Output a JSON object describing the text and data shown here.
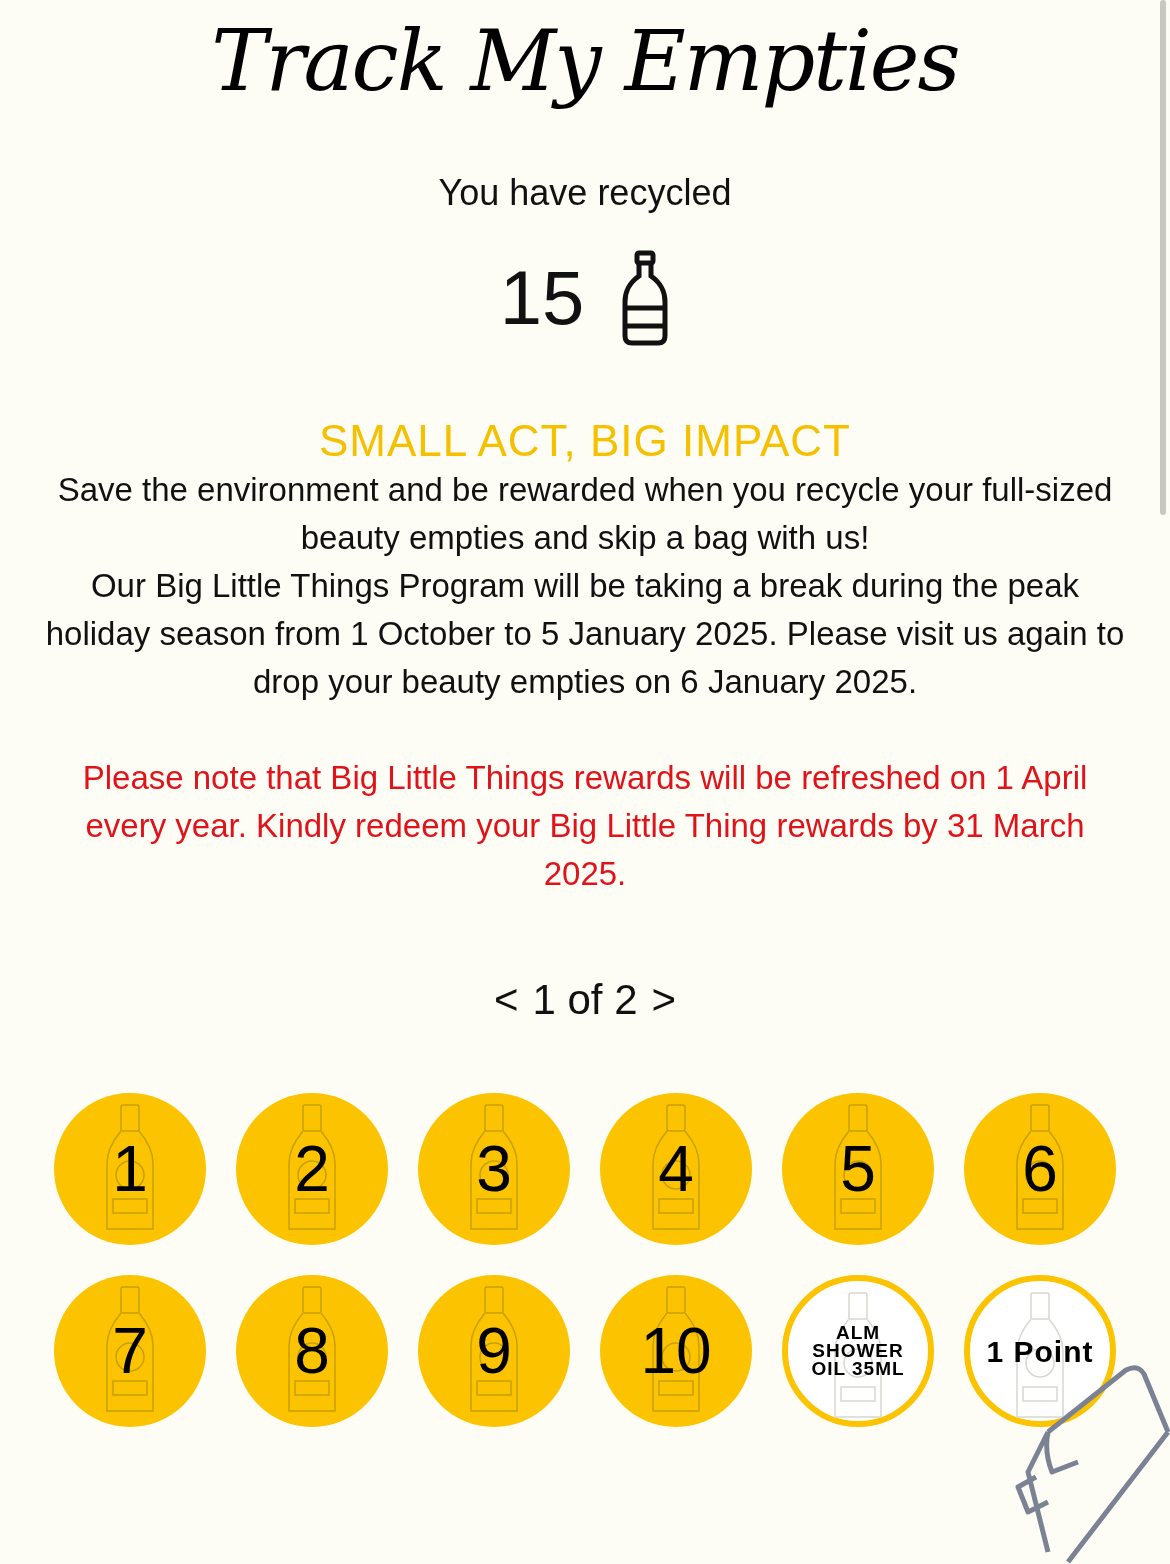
{
  "title": "Track My Empties",
  "recycled": {
    "label": "You have recycled",
    "count": "15"
  },
  "heading": "SMALL ACT, BIG IMPACT",
  "paragraphs": [
    "Save the environment and be rewarded when you recycle your full-sized beauty empties and skip a bag with us!",
    "Our Big Little Things Program will be taking a break during the peak holiday season from 1 October to 5 January 2025. Please visit us again to drop your beauty empties on 6 January 2025."
  ],
  "notice": "Please note that Big Little Things rewards will be refreshed on 1 April every year. Kindly redeem your Big Little Thing rewards by 31 March 2025.",
  "pager": {
    "prev": "<",
    "label": "1 of 2",
    "next": ">"
  },
  "stamps": [
    {
      "kind": "filled",
      "label": "1"
    },
    {
      "kind": "filled",
      "label": "2"
    },
    {
      "kind": "filled",
      "label": "3"
    },
    {
      "kind": "filled",
      "label": "4"
    },
    {
      "kind": "filled",
      "label": "5"
    },
    {
      "kind": "filled",
      "label": "6"
    },
    {
      "kind": "filled",
      "label": "7"
    },
    {
      "kind": "filled",
      "label": "8"
    },
    {
      "kind": "filled",
      "label": "9"
    },
    {
      "kind": "filled",
      "label": "10"
    },
    {
      "kind": "reward",
      "label": "ALM SHOWER OIL 35ML"
    },
    {
      "kind": "points",
      "label": "1 Point"
    }
  ]
}
